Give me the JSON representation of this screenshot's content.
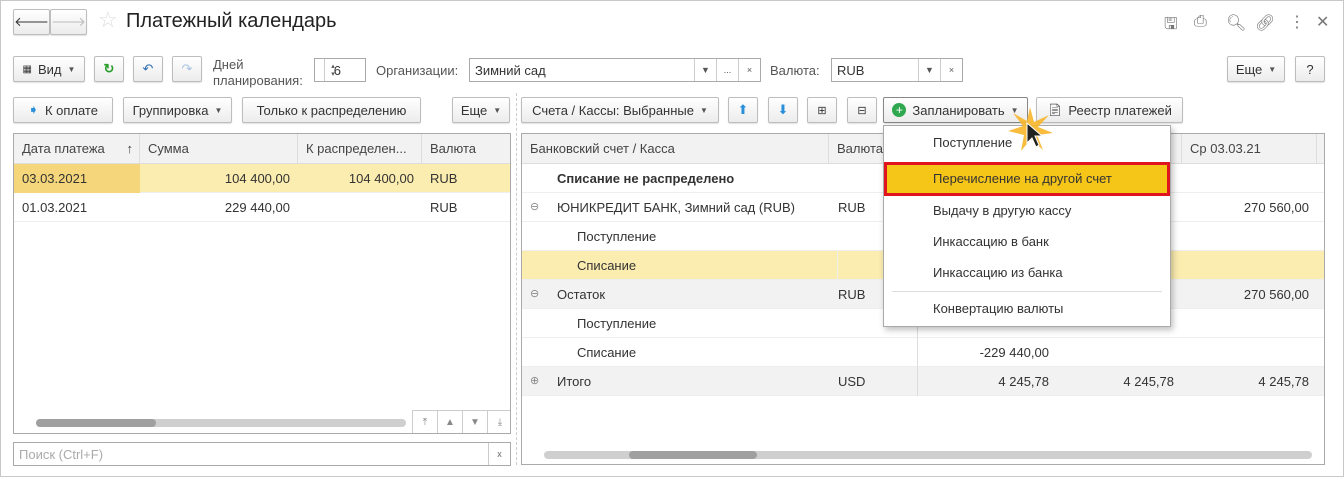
{
  "window": {
    "title": "Платежный календарь"
  },
  "toolbar": {
    "view": "Вид",
    "days_label_1": "Дней",
    "days_label_2": "планирования:",
    "days_value": "6",
    "org_label": "Организации:",
    "org_value": "Зимний сад",
    "org_more": "...",
    "clear": "×",
    "currency_label": "Валюта:",
    "currency_value": "RUB",
    "more": "Еще",
    "help": "?"
  },
  "left": {
    "pay": "К оплате",
    "grouping": "Группировка",
    "only_dist": "Только к распределению",
    "more": "Еще",
    "columns": [
      "Дата платежа",
      "Сумма",
      "К распределен...",
      "Валюта"
    ],
    "rows": [
      [
        "03.03.2021",
        "104 400,00",
        "104 400,00",
        "RUB"
      ],
      [
        "01.03.2021",
        "229 440,00",
        "",
        "RUB"
      ]
    ],
    "search_placeholder": "Поиск (Ctrl+F)",
    "search_clear": "x"
  },
  "right": {
    "accounts": "Счета / Кассы: Выбранные",
    "plan": "Запланировать",
    "registry": "Реестр платежей",
    "columns": [
      "Банковский счет / Касса",
      "Валюта",
      "",
      "",
      "Ср 03.03.21"
    ],
    "rows": [
      {
        "name": "Списание не распределено",
        "cur": "",
        "v1": "",
        "v2": "",
        "v3": ""
      },
      {
        "name": "ЮНИКРЕДИТ БАНК, Зимний сад (RUB)",
        "cur": "RUB",
        "v1": "",
        "v2": "",
        "v3": "270 560,00"
      },
      {
        "name": "Поступление",
        "cur": "",
        "v1": "",
        "v2": "",
        "v3": ""
      },
      {
        "name": "Списание",
        "cur": "",
        "v1": "",
        "v2": "",
        "v3": ""
      },
      {
        "name": "Остаток",
        "cur": "RUB",
        "v1": "",
        "v2": "",
        "v3": "270 560,00"
      },
      {
        "name": "Поступление",
        "cur": "",
        "v1": "",
        "v2": "",
        "v3": ""
      },
      {
        "name": "Списание",
        "cur": "",
        "v1": "-229 440,00",
        "v2": "",
        "v3": ""
      },
      {
        "name": "Итого",
        "cur": "USD",
        "v1": "4 245,78",
        "v2": "4 245,78",
        "v3": "4 245,78"
      }
    ]
  },
  "menu": {
    "items": [
      "Поступление",
      "Перечисление на другой счет",
      "Выдачу в другую кассу",
      "Инкассацию в банк",
      "Инкассацию из банка",
      "Конвертацию валюты"
    ]
  },
  "colors": {
    "selected": "#fbedb0",
    "highlight": "#f5c518",
    "highlight_border": "#e0141e"
  }
}
